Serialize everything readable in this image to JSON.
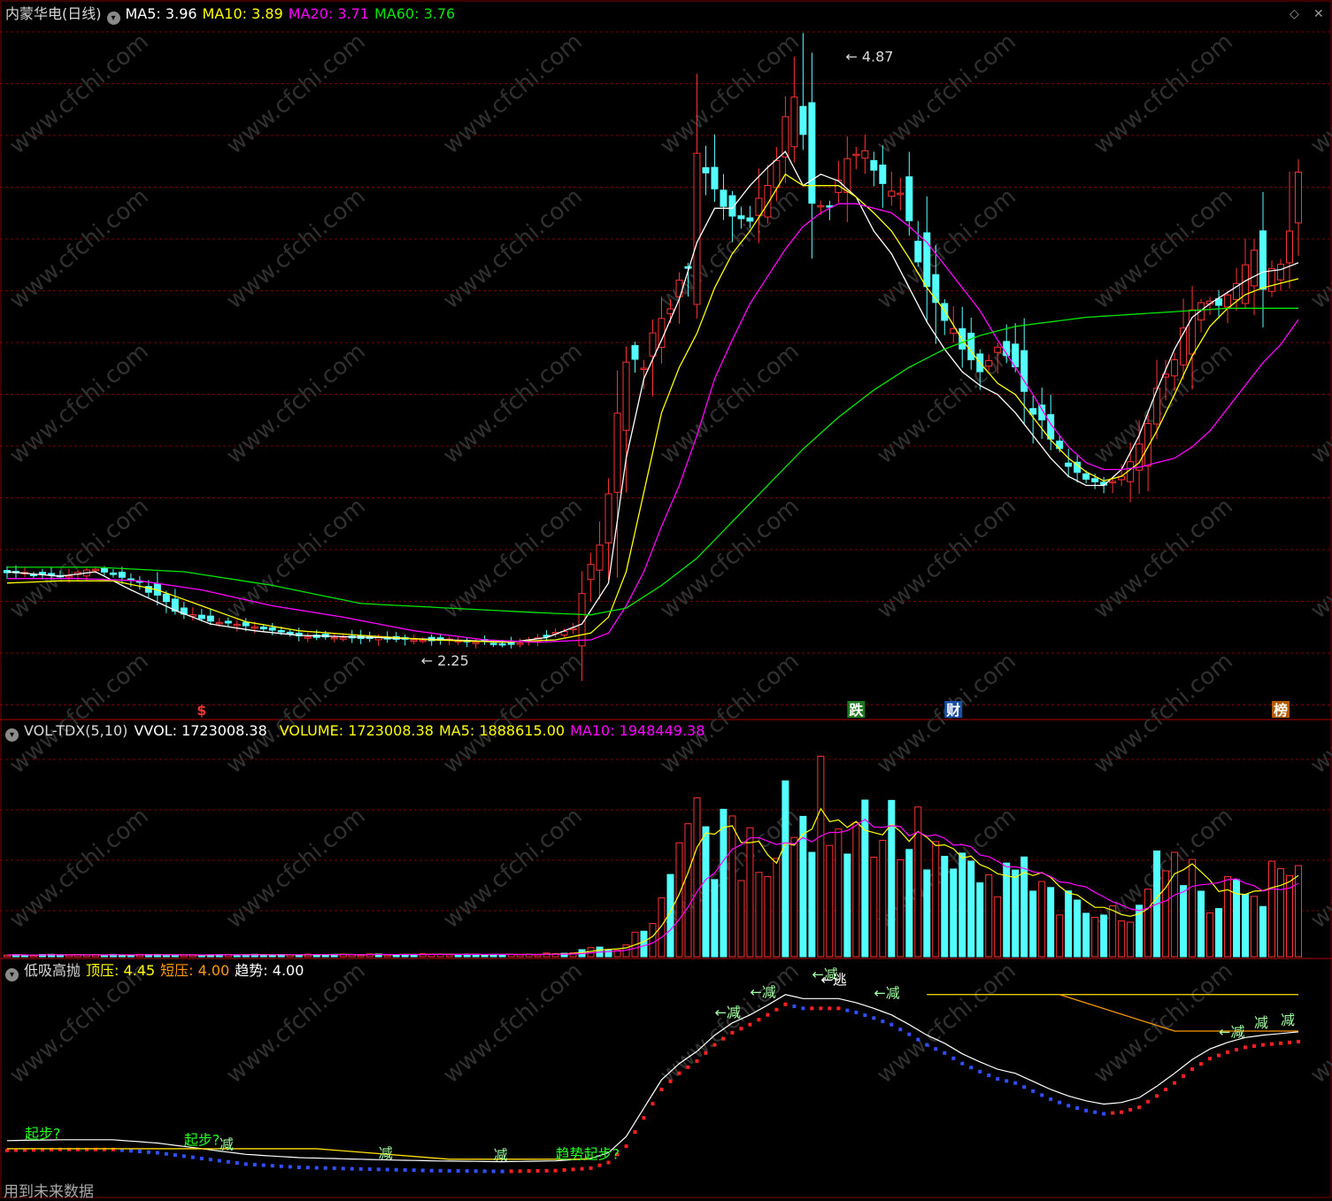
{
  "header": {
    "stock_name": "内蒙华电(日线)",
    "ma5_label": "MA5:",
    "ma5_value": "3.96",
    "ma10_label": "MA10:",
    "ma10_value": "3.89",
    "ma20_label": "MA20:",
    "ma20_value": "3.71",
    "ma60_label": "MA60:",
    "ma60_value": "3.76"
  },
  "vol_header": {
    "indicator": "VOL-TDX(5,10)",
    "vvol_label": "VVOL:",
    "vvol_value": "1723008.38",
    "volume_label": "VOLUME:",
    "volume_value": "1723008.38",
    "ma5_label": "MA5:",
    "ma5_value": "1888615.00",
    "ma10_label": "MA10:",
    "ma10_value": "1948449.38"
  },
  "ind_header": {
    "name": "低吸高抛",
    "top_label": "顶压:",
    "top_value": "4.45",
    "short_label": "短压:",
    "short_value": "4.00",
    "trend_label": "趋势:",
    "trend_value": "4.00"
  },
  "footer": {
    "note": "用到未来数据"
  },
  "colors": {
    "up": "#ff3232",
    "down": "#54ffff",
    "ma5": "#ffffff",
    "ma10": "#ffff00",
    "ma20": "#ff00ff",
    "ma60": "#00e600",
    "grid": "#7a0000",
    "watermark": "#303030"
  },
  "chart_data": [
    {
      "type": "candlestick",
      "title": "内蒙华电(日线)",
      "price_annotations": {
        "high": "4.87",
        "low": "2.25"
      },
      "event_markers": [
        {
          "label": "$",
          "color": "#ff3232"
        },
        {
          "label": "跌",
          "color": "#ffffff",
          "bg": "#1e7a1e"
        },
        {
          "label": "财",
          "color": "#ffffff",
          "bg": "#1a4fa8"
        },
        {
          "label": "榜",
          "color": "#ffffff",
          "bg": "#b35a00"
        }
      ],
      "series": [
        {
          "name": "MA5",
          "last": 3.96
        },
        {
          "name": "MA10",
          "last": 3.89
        },
        {
          "name": "MA20",
          "last": 3.71
        },
        {
          "name": "MA60",
          "last": 3.76
        }
      ],
      "close_path": [
        [
          0,
          2.6
        ],
        [
          6,
          2.58
        ],
        [
          10,
          2.61
        ],
        [
          15,
          2.55
        ],
        [
          19,
          2.43
        ],
        [
          23,
          2.38
        ],
        [
          28,
          2.36
        ],
        [
          33,
          2.32
        ],
        [
          37,
          2.31
        ],
        [
          42,
          2.31
        ],
        [
          46,
          2.3
        ],
        [
          50,
          2.3
        ],
        [
          54,
          2.29
        ],
        [
          57,
          2.28
        ],
        [
          61,
          2.32
        ],
        [
          64,
          2.35
        ],
        [
          66,
          2.6
        ],
        [
          68,
          2.9
        ],
        [
          70,
          3.6
        ],
        [
          72,
          3.5
        ],
        [
          74,
          3.75
        ],
        [
          75,
          3.75
        ],
        [
          77,
          3.95
        ],
        [
          78,
          4.45
        ],
        [
          80,
          4.3
        ],
        [
          82,
          4.15
        ],
        [
          84,
          4.15
        ],
        [
          86,
          4.3
        ],
        [
          87,
          4.4
        ],
        [
          89,
          4.75
        ],
        [
          91,
          4.2
        ],
        [
          93,
          4.2
        ],
        [
          95,
          4.4
        ],
        [
          97,
          4.45
        ],
        [
          99,
          4.3
        ],
        [
          101,
          4.25
        ],
        [
          103,
          4.0
        ],
        [
          105,
          3.75
        ],
        [
          108,
          3.6
        ],
        [
          110,
          3.5
        ],
        [
          112,
          3.6
        ],
        [
          114,
          3.5
        ],
        [
          116,
          3.3
        ],
        [
          118,
          3.2
        ],
        [
          120,
          3.05
        ],
        [
          122,
          3.0
        ],
        [
          124,
          2.98
        ],
        [
          126,
          3.02
        ],
        [
          128,
          3.15
        ],
        [
          130,
          3.4
        ],
        [
          132,
          3.55
        ],
        [
          134,
          3.75
        ],
        [
          136,
          3.8
        ],
        [
          137,
          3.78
        ],
        [
          139,
          3.85
        ],
        [
          141,
          4.0
        ],
        [
          142,
          3.88
        ],
        [
          144,
          3.95
        ],
        [
          146,
          4.33
        ]
      ],
      "ma_lines": {
        "MA5": [
          [
            0,
            2.6
          ],
          [
            6,
            2.58
          ],
          [
            10,
            2.6
          ],
          [
            14,
            2.52
          ],
          [
            19,
            2.43
          ],
          [
            23,
            2.37
          ],
          [
            28,
            2.34
          ],
          [
            33,
            2.32
          ],
          [
            42,
            2.31
          ],
          [
            50,
            2.3
          ],
          [
            57,
            2.29
          ],
          [
            61,
            2.31
          ],
          [
            65,
            2.37
          ],
          [
            68,
            2.55
          ],
          [
            70,
            3.1
          ],
          [
            72,
            3.45
          ],
          [
            74,
            3.62
          ],
          [
            76,
            3.8
          ],
          [
            78,
            4.05
          ],
          [
            80,
            4.2
          ],
          [
            82,
            4.2
          ],
          [
            84,
            4.3
          ],
          [
            86,
            4.38
          ],
          [
            88,
            4.45
          ],
          [
            90,
            4.3
          ],
          [
            92,
            4.35
          ],
          [
            94,
            4.32
          ],
          [
            96,
            4.25
          ],
          [
            98,
            4.1
          ],
          [
            100,
            4.0
          ],
          [
            102,
            3.85
          ],
          [
            104,
            3.7
          ],
          [
            106,
            3.58
          ],
          [
            108,
            3.48
          ],
          [
            110,
            3.42
          ],
          [
            112,
            3.38
          ],
          [
            114,
            3.3
          ],
          [
            116,
            3.2
          ],
          [
            118,
            3.1
          ],
          [
            120,
            3.02
          ],
          [
            122,
            2.98
          ],
          [
            124,
            2.98
          ],
          [
            126,
            3.05
          ],
          [
            128,
            3.2
          ],
          [
            130,
            3.4
          ],
          [
            132,
            3.58
          ],
          [
            134,
            3.72
          ],
          [
            136,
            3.78
          ],
          [
            138,
            3.83
          ],
          [
            140,
            3.88
          ],
          [
            142,
            3.92
          ],
          [
            144,
            3.93
          ],
          [
            146,
            3.96
          ]
        ],
        "MA10": [
          [
            0,
            2.55
          ],
          [
            6,
            2.56
          ],
          [
            12,
            2.56
          ],
          [
            17,
            2.52
          ],
          [
            22,
            2.45
          ],
          [
            27,
            2.38
          ],
          [
            33,
            2.34
          ],
          [
            40,
            2.32
          ],
          [
            48,
            2.3
          ],
          [
            56,
            2.29
          ],
          [
            62,
            2.3
          ],
          [
            66,
            2.33
          ],
          [
            68,
            2.4
          ],
          [
            70,
            2.6
          ],
          [
            72,
            2.95
          ],
          [
            74,
            3.3
          ],
          [
            76,
            3.5
          ],
          [
            78,
            3.65
          ],
          [
            80,
            3.85
          ],
          [
            82,
            4.0
          ],
          [
            84,
            4.1
          ],
          [
            86,
            4.22
          ],
          [
            88,
            4.35
          ],
          [
            90,
            4.3
          ],
          [
            92,
            4.3
          ],
          [
            94,
            4.3
          ],
          [
            96,
            4.25
          ],
          [
            98,
            4.18
          ],
          [
            100,
            4.1
          ],
          [
            102,
            3.98
          ],
          [
            104,
            3.85
          ],
          [
            106,
            3.75
          ],
          [
            108,
            3.62
          ],
          [
            110,
            3.52
          ],
          [
            112,
            3.43
          ],
          [
            114,
            3.38
          ],
          [
            116,
            3.28
          ],
          [
            118,
            3.18
          ],
          [
            120,
            3.1
          ],
          [
            122,
            3.04
          ],
          [
            124,
            3.0
          ],
          [
            126,
            3.02
          ],
          [
            128,
            3.08
          ],
          [
            130,
            3.22
          ],
          [
            132,
            3.38
          ],
          [
            134,
            3.55
          ],
          [
            136,
            3.68
          ],
          [
            138,
            3.76
          ],
          [
            140,
            3.82
          ],
          [
            142,
            3.85
          ],
          [
            144,
            3.87
          ],
          [
            146,
            3.89
          ]
        ],
        "MA20": [
          [
            0,
            2.57
          ],
          [
            8,
            2.57
          ],
          [
            15,
            2.56
          ],
          [
            22,
            2.52
          ],
          [
            30,
            2.45
          ],
          [
            38,
            2.4
          ],
          [
            46,
            2.34
          ],
          [
            54,
            2.3
          ],
          [
            60,
            2.29
          ],
          [
            66,
            2.3
          ],
          [
            68,
            2.33
          ],
          [
            70,
            2.45
          ],
          [
            72,
            2.6
          ],
          [
            74,
            2.8
          ],
          [
            76,
            2.98
          ],
          [
            78,
            3.2
          ],
          [
            80,
            3.45
          ],
          [
            82,
            3.62
          ],
          [
            84,
            3.78
          ],
          [
            86,
            3.9
          ],
          [
            88,
            4.02
          ],
          [
            90,
            4.12
          ],
          [
            92,
            4.18
          ],
          [
            94,
            4.22
          ],
          [
            96,
            4.22
          ],
          [
            98,
            4.2
          ],
          [
            100,
            4.18
          ],
          [
            102,
            4.12
          ],
          [
            104,
            4.05
          ],
          [
            106,
            3.95
          ],
          [
            108,
            3.85
          ],
          [
            110,
            3.75
          ],
          [
            112,
            3.62
          ],
          [
            114,
            3.5
          ],
          [
            116,
            3.38
          ],
          [
            118,
            3.25
          ],
          [
            120,
            3.15
          ],
          [
            122,
            3.08
          ],
          [
            124,
            3.05
          ],
          [
            126,
            3.05
          ],
          [
            128,
            3.06
          ],
          [
            130,
            3.08
          ],
          [
            132,
            3.1
          ],
          [
            134,
            3.15
          ],
          [
            136,
            3.22
          ],
          [
            138,
            3.32
          ],
          [
            140,
            3.42
          ],
          [
            142,
            3.52
          ],
          [
            144,
            3.6
          ],
          [
            146,
            3.71
          ]
        ],
        "MA60": [
          [
            0,
            2.62
          ],
          [
            10,
            2.62
          ],
          [
            20,
            2.6
          ],
          [
            30,
            2.54
          ],
          [
            40,
            2.46
          ],
          [
            50,
            2.44
          ],
          [
            60,
            2.42
          ],
          [
            66,
            2.41
          ],
          [
            70,
            2.44
          ],
          [
            74,
            2.54
          ],
          [
            78,
            2.66
          ],
          [
            82,
            2.82
          ],
          [
            86,
            2.98
          ],
          [
            90,
            3.14
          ],
          [
            94,
            3.28
          ],
          [
            98,
            3.4
          ],
          [
            102,
            3.5
          ],
          [
            106,
            3.58
          ],
          [
            110,
            3.64
          ],
          [
            114,
            3.68
          ],
          [
            118,
            3.7
          ],
          [
            122,
            3.72
          ],
          [
            126,
            3.73
          ],
          [
            130,
            3.74
          ],
          [
            134,
            3.75
          ],
          [
            138,
            3.76
          ],
          [
            142,
            3.76
          ],
          [
            146,
            3.76
          ]
        ]
      },
      "ylim": [
        2.0,
        5.0
      ]
    },
    {
      "type": "bar",
      "title": "VOL-TDX(5,10)",
      "volume_envelope": [
        [
          0,
          40000
        ],
        [
          30,
          40000
        ],
        [
          60,
          60000
        ],
        [
          62,
          90000
        ],
        [
          64,
          120000
        ],
        [
          66,
          150000
        ],
        [
          68,
          180000
        ],
        [
          70,
          250000
        ],
        [
          72,
          600000
        ],
        [
          74,
          1300000
        ],
        [
          75,
          2300000
        ],
        [
          76,
          2900000
        ],
        [
          78,
          2700000
        ],
        [
          80,
          2600000
        ],
        [
          82,
          2400000
        ],
        [
          84,
          2200000
        ],
        [
          86,
          2500000
        ],
        [
          88,
          3500000
        ],
        [
          89,
          3200000
        ],
        [
          91,
          2800000
        ],
        [
          92,
          3700000
        ],
        [
          93,
          3300000
        ],
        [
          94,
          3000000
        ],
        [
          96,
          3000000
        ],
        [
          98,
          3100000
        ],
        [
          100,
          2800000
        ],
        [
          102,
          2700000
        ],
        [
          104,
          2400000
        ],
        [
          106,
          2100000
        ],
        [
          108,
          1800000
        ],
        [
          110,
          1600000
        ],
        [
          112,
          1500000
        ],
        [
          114,
          2000000
        ],
        [
          116,
          1500000
        ],
        [
          118,
          1300000
        ],
        [
          120,
          1100000
        ],
        [
          122,
          900000
        ],
        [
          124,
          1000000
        ],
        [
          126,
          800000
        ],
        [
          128,
          1500000
        ],
        [
          130,
          2100000
        ],
        [
          131,
          2700000
        ],
        [
          132,
          1800000
        ],
        [
          134,
          1600000
        ],
        [
          136,
          1500000
        ],
        [
          138,
          1400000
        ],
        [
          140,
          1700000
        ],
        [
          142,
          1600000
        ],
        [
          144,
          1900000
        ],
        [
          146,
          1723008
        ]
      ],
      "series": [
        {
          "name": "MA5",
          "last": 1888615.0
        },
        {
          "name": "MA10",
          "last": 1948449.38
        }
      ],
      "ylim": [
        0,
        4000000
      ]
    },
    {
      "type": "line",
      "title": "低吸高抛",
      "signal_labels": [
        "起步?",
        "起步?",
        "减",
        "减",
        "减",
        "趋势起步?",
        "←减",
        "←减",
        "←减",
        "←逃",
        "←减",
        "←减",
        "减",
        "减"
      ],
      "series": [
        {
          "name": "顶压",
          "last": 4.45
        },
        {
          "name": "短压",
          "last": 4.0
        },
        {
          "name": "趋势",
          "last": 4.0
        }
      ]
    }
  ]
}
